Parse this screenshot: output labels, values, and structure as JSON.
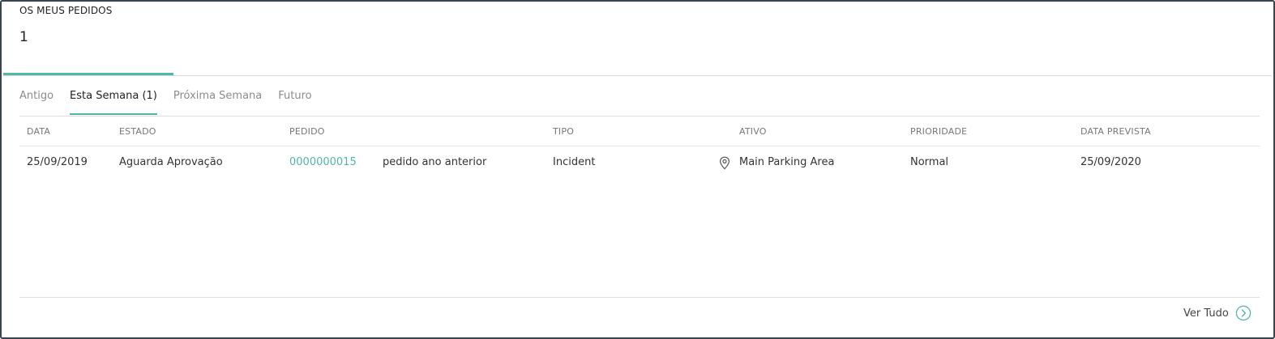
{
  "widget": {
    "title": "OS MEUS PEDIDOS",
    "count": "1"
  },
  "tabs": [
    {
      "label": "Antigo",
      "active": false
    },
    {
      "label": "Esta Semana (1)",
      "active": true
    },
    {
      "label": "Próxima Semana",
      "active": false
    },
    {
      "label": "Futuro",
      "active": false
    }
  ],
  "table": {
    "headers": {
      "date": "DATA",
      "status": "ESTADO",
      "request": "PEDIDO",
      "type": "TIPO",
      "asset": "ATIVO",
      "priority": "PRIORIDADE",
      "due_date": "DATA PREVISTA"
    },
    "rows": [
      {
        "date": "25/09/2019",
        "status": "Aguarda Aprovação",
        "request_id": "0000000015",
        "description": "pedido ano anterior",
        "type": "Incident",
        "asset_icon": "location-pin-icon",
        "asset": "Main Parking Area",
        "priority": "Normal",
        "due_date": "25/09/2020"
      }
    ]
  },
  "footer": {
    "view_all_label": "Ver Tudo",
    "view_all_icon": "chevron-right-circle-icon"
  },
  "colors": {
    "accent": "#4fb6a8",
    "frame_border": "#3a4450",
    "muted_text": "#8b8b8b"
  }
}
